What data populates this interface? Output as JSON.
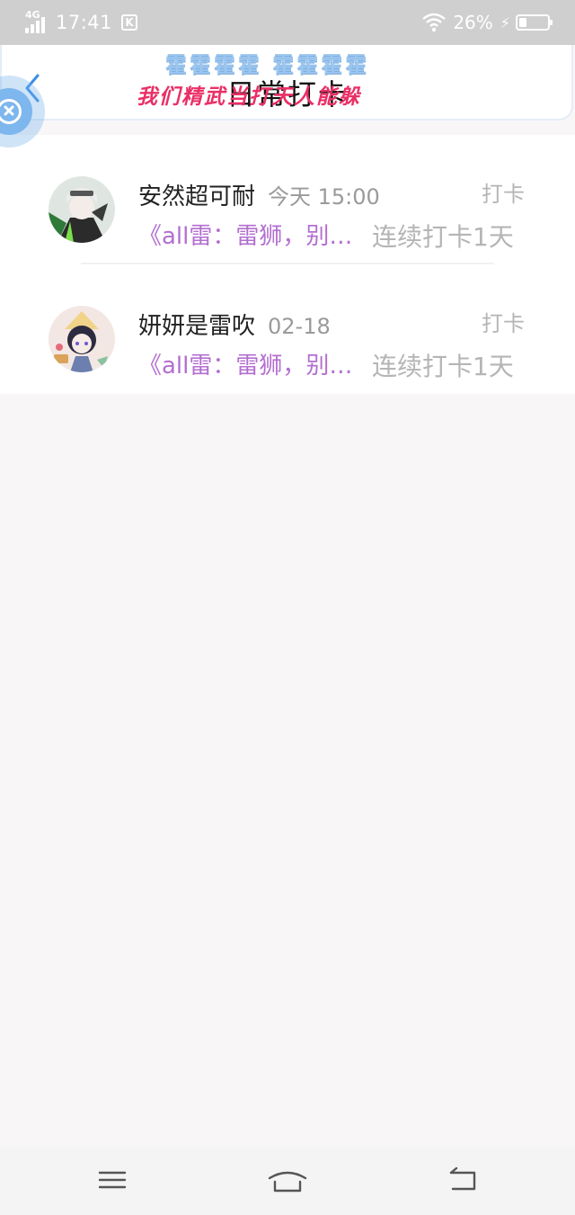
{
  "status_bar": {
    "network": "4G",
    "time": "17:41",
    "app_badge": "K",
    "battery_percent": "26%",
    "battery_level": 0.26,
    "charging": true
  },
  "header": {
    "title": "日常打卡",
    "decor_top": "霍霍霍霍 霍霍霍霍",
    "decor_bottom": "我们精武当打天人能躲"
  },
  "checkins": [
    {
      "user": "安然超可耐",
      "time": "今天 15:00",
      "tag": "打卡",
      "title": "《all雷：雷狮，别…",
      "streak": "连续打卡1天"
    },
    {
      "user": "妍妍是雷吹",
      "time": "02-18",
      "tag": "打卡",
      "title": "《all雷：雷狮，别…",
      "streak": "连续打卡1天"
    }
  ],
  "colors": {
    "accent_blue": "#3a8ee6",
    "preview_purple": "#b36fd0",
    "status_bar_bg": "#cfcfcf",
    "page_bg": "#f8f6f7"
  },
  "icons": {
    "back": "chevron-left-icon",
    "floating": "close-circle-icon",
    "nav_menu": "menu-icon",
    "nav_home": "home-icon",
    "nav_back": "back-icon"
  }
}
